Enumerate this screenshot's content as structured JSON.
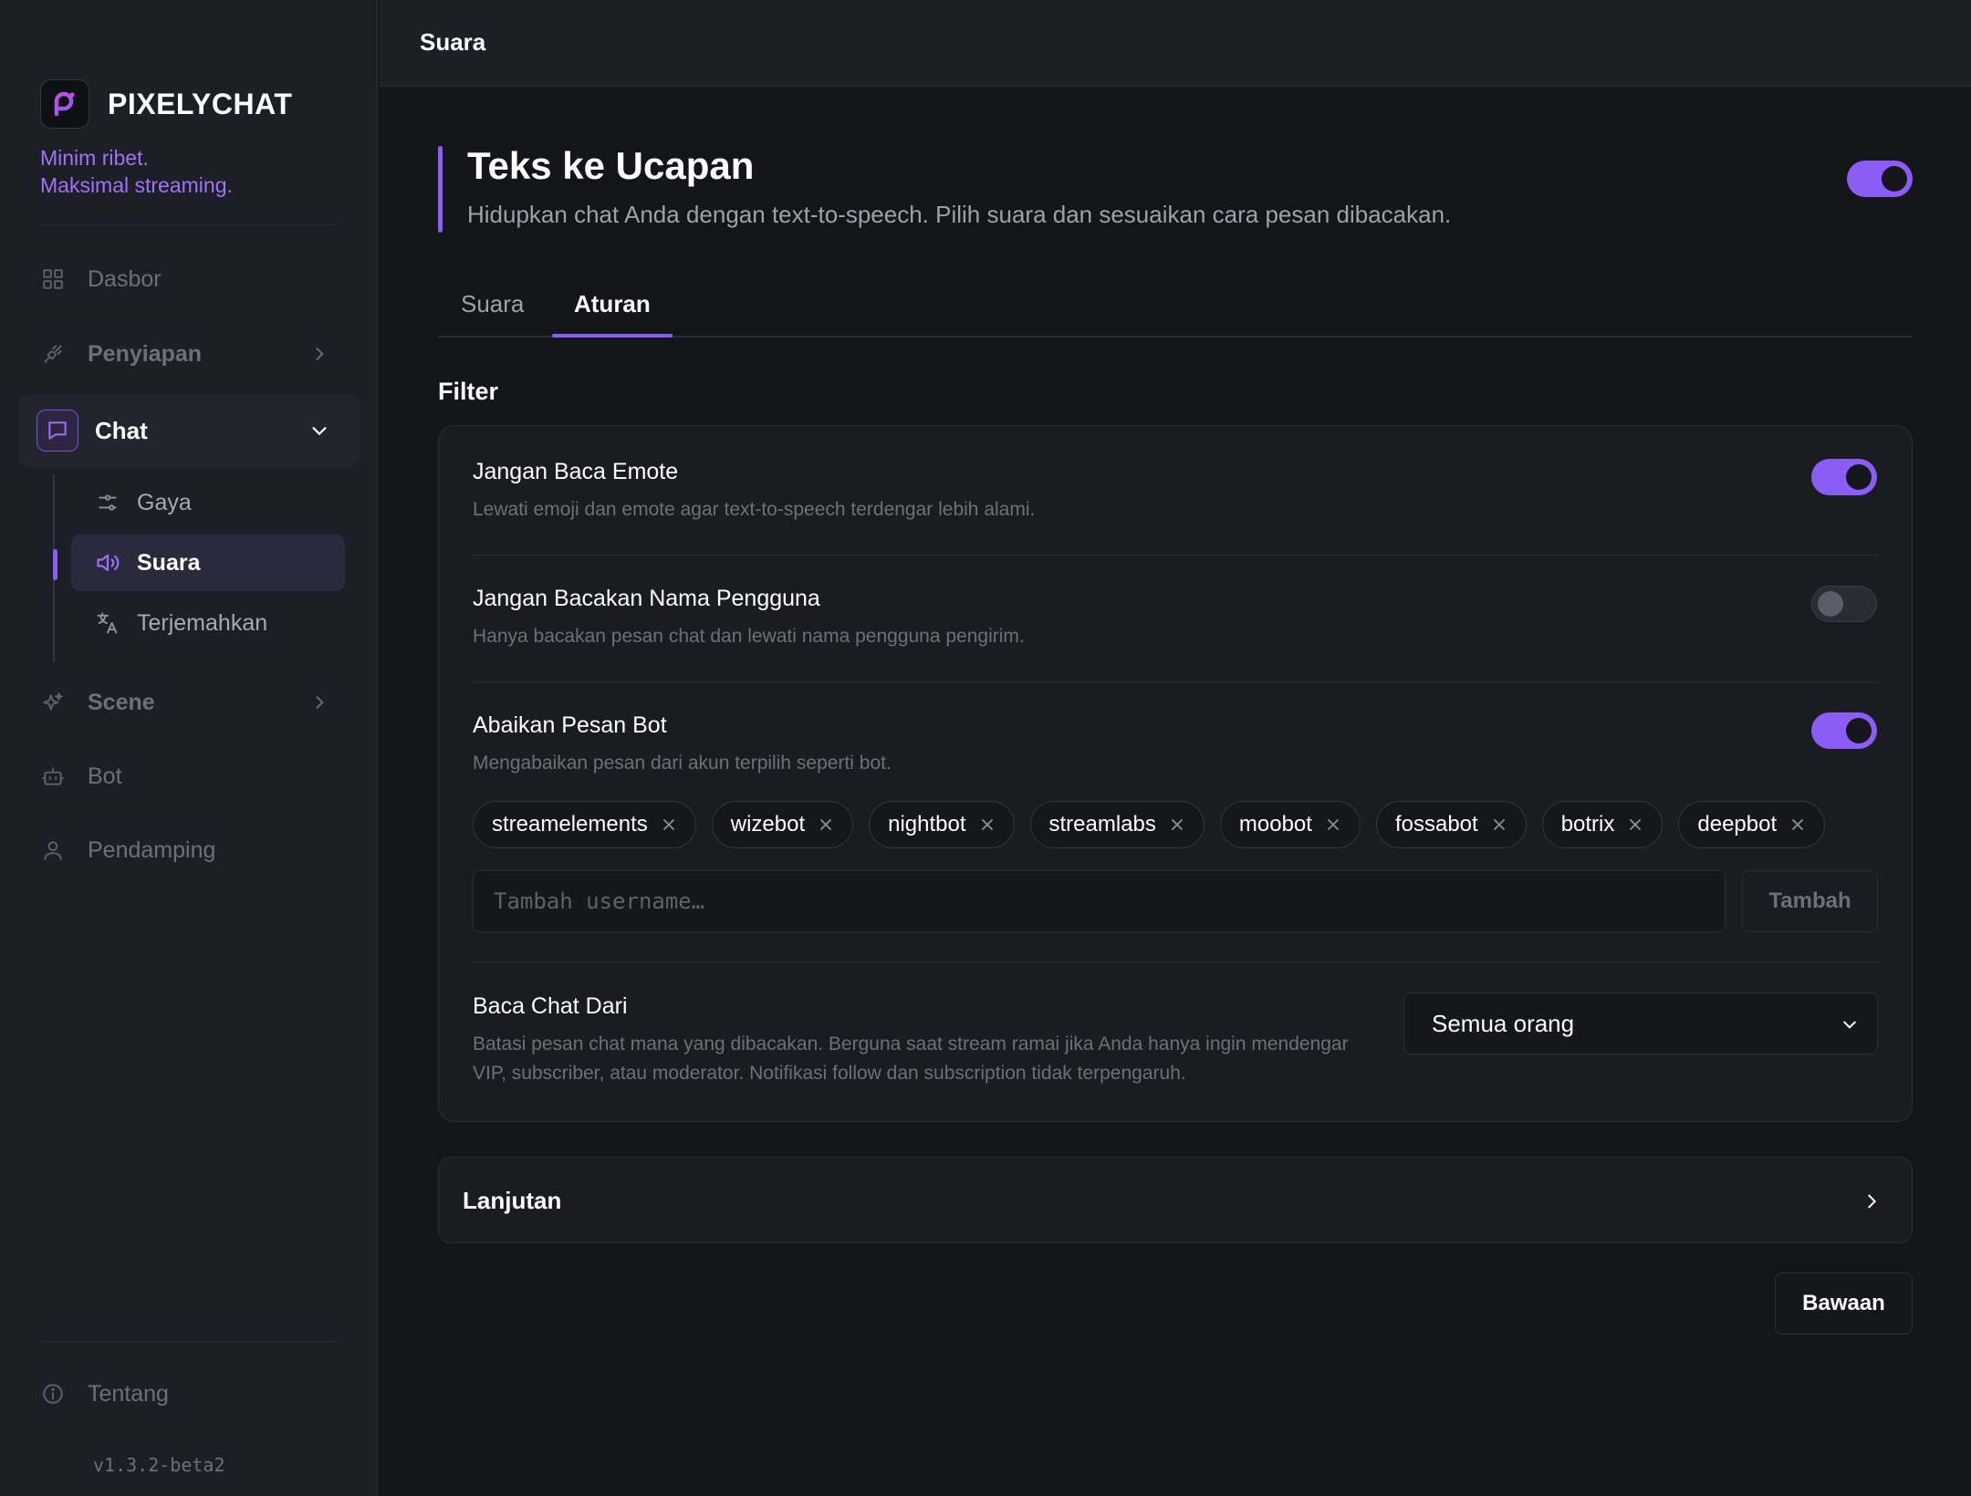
{
  "brand": {
    "name": "PIXELYCHAT",
    "tagline_line1": "Minim ribet.",
    "tagline_line2": "Maksimal streaming.",
    "accent_color": "#8b5cf6"
  },
  "sidebar": {
    "items": [
      {
        "label": "Dasbor",
        "icon": "grid-icon"
      },
      {
        "label": "Penyiapan",
        "icon": "plug-icon"
      },
      {
        "label": "Chat",
        "icon": "chat-bubble-icon",
        "expanded": true
      },
      {
        "label": "Scene",
        "icon": "sparkles-icon"
      },
      {
        "label": "Bot",
        "icon": "robot-icon"
      },
      {
        "label": "Pendamping",
        "icon": "user-icon"
      }
    ],
    "chat_subitems": [
      {
        "label": "Gaya",
        "icon": "sliders-icon"
      },
      {
        "label": "Suara",
        "icon": "speaker-icon",
        "active": true
      },
      {
        "label": "Terjemahkan",
        "icon": "translate-icon"
      }
    ],
    "footer": {
      "about_label": "Tentang",
      "version": "v1.3.2-beta2"
    }
  },
  "topbar": {
    "title": "Suara"
  },
  "page": {
    "title": "Teks ke Ucapan",
    "description": "Hidupkan chat Anda dengan text-to-speech. Pilih suara dan sesuaikan cara pesan dibacakan.",
    "enabled": true
  },
  "tabs": [
    {
      "label": "Suara",
      "active": false
    },
    {
      "label": "Aturan",
      "active": true
    }
  ],
  "filter": {
    "section_title": "Filter",
    "rows": [
      {
        "title": "Jangan Baca Emote",
        "description": "Lewati emoji dan emote agar text-to-speech terdengar lebih alami.",
        "enabled": true
      },
      {
        "title": "Jangan Bacakan Nama Pengguna",
        "description": "Hanya bacakan pesan chat dan lewati nama pengguna pengirim.",
        "enabled": false
      },
      {
        "title": "Abaikan Pesan Bot",
        "description": "Mengabaikan pesan dari akun terpilih seperti bot.",
        "enabled": true
      }
    ],
    "bots": [
      "streamelements",
      "wizebot",
      "nightbot",
      "streamlabs",
      "moobot",
      "fossabot",
      "botrix",
      "deepbot"
    ],
    "username_placeholder": "Tambah username…",
    "add_button_label": "Tambah",
    "read_from": {
      "title": "Baca Chat Dari",
      "description": "Batasi pesan chat mana yang dibacakan. Berguna saat stream ramai jika Anda hanya ingin mendengar VIP, subscriber, atau moderator. Notifikasi follow dan subscription tidak terpengaruh.",
      "selected": "Semua orang"
    }
  },
  "advanced": {
    "label": "Lanjutan"
  },
  "default_button_label": "Bawaan"
}
